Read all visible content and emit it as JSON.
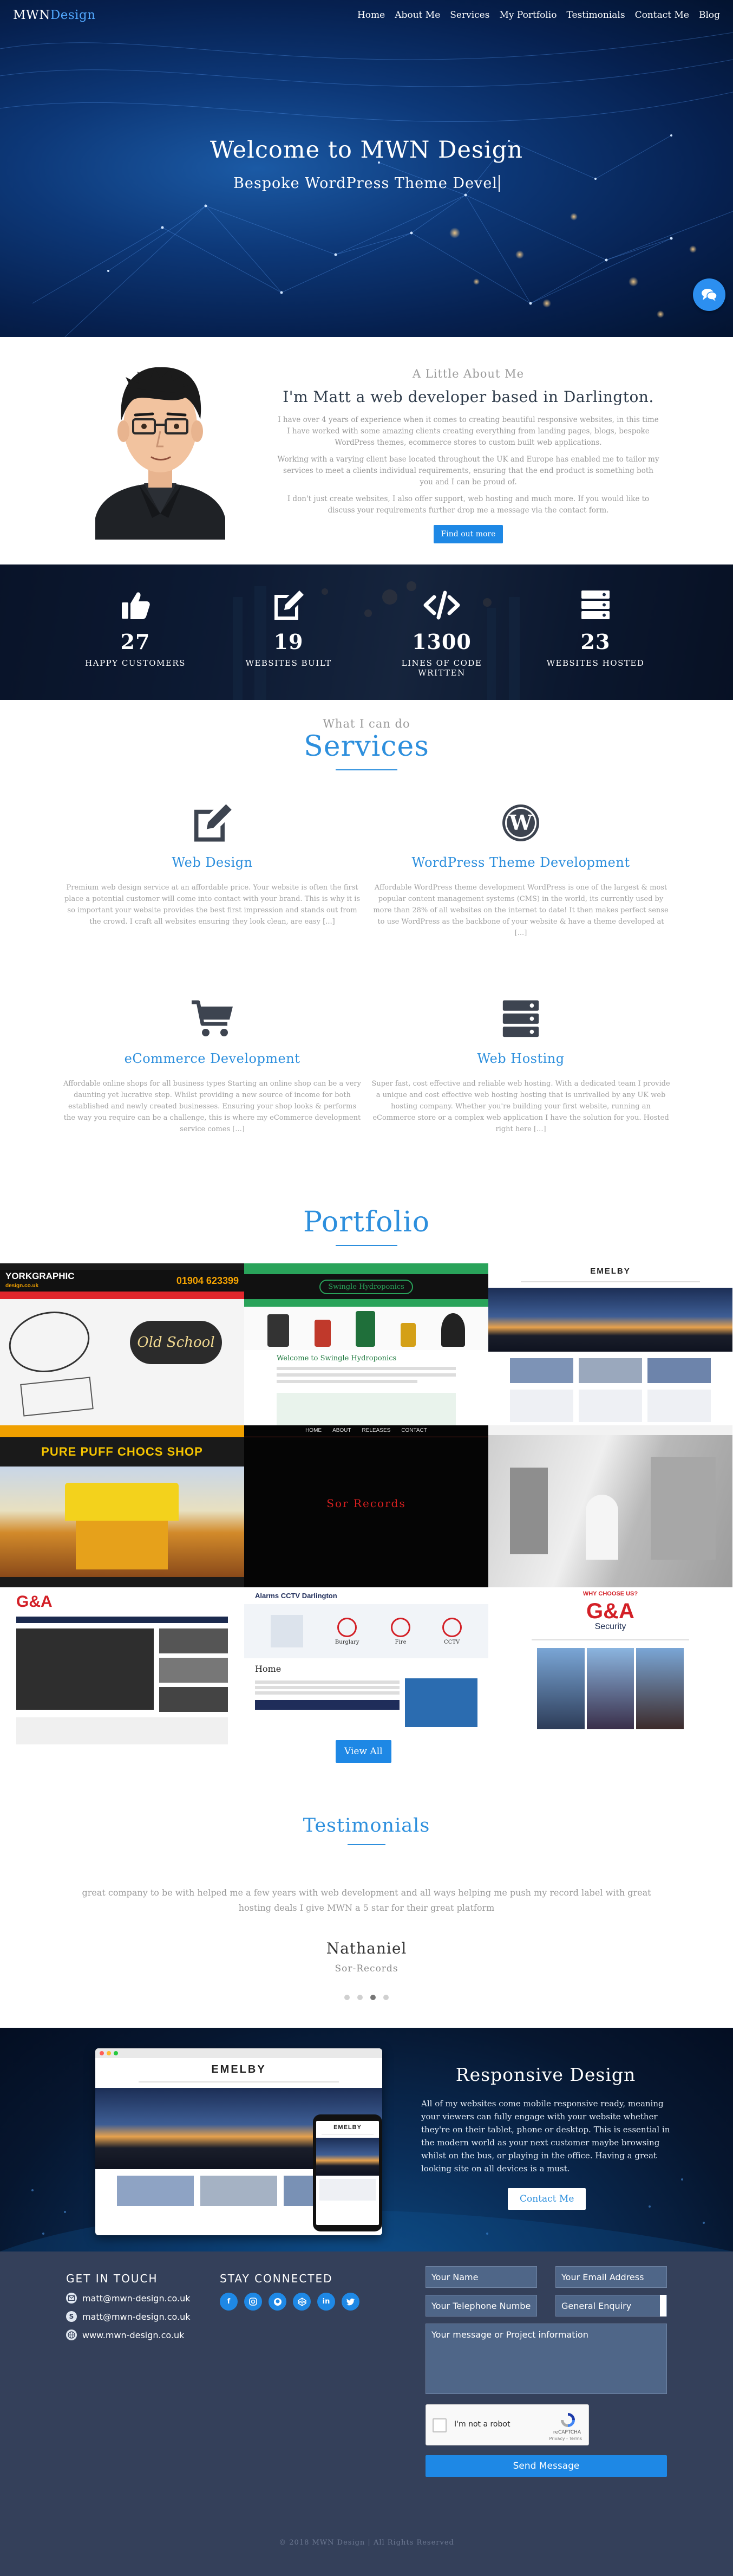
{
  "nav": {
    "logo_main": "MWN",
    "logo_accent": "Design",
    "items": [
      "Home",
      "About Me",
      "Services",
      "My Portfolio",
      "Testimonials",
      "Contact Me",
      "Blog"
    ]
  },
  "hero": {
    "title": "Welcome to MWN Design",
    "subtitle": "Bespoke WordPress Theme Devel",
    "chat_icon": "chat-bubbles-icon"
  },
  "about": {
    "kicker": "A Little About Me",
    "heading": "I'm Matt a web developer based in Darlington.",
    "p1": "I have over 4 years of experience when it comes to creating beautiful responsive websites, in this time I have worked with some amazing clients creating everything from landing pages, blogs, bespoke WordPress themes, ecommerce stores to custom built web applications.",
    "p2": "Working with a varying client base located throughout the UK and Europe has enabled me to tailor my services to meet a clients individual requirements, ensuring that the end product is something both you and I can be proud of.",
    "p3": "I don't just create websites, I also offer support, web hosting and much more. If you would like to discuss your requirements further drop me a message via the contact form.",
    "button": "Find out more"
  },
  "stats": [
    {
      "icon": "thumbs-up-icon",
      "value": "27",
      "label": "HAPPY CUSTOMERS"
    },
    {
      "icon": "edit-icon",
      "value": "19",
      "label": "WEBSITES BUILT"
    },
    {
      "icon": "code-icon",
      "value": "1300",
      "label": "LINES OF CODE WRITTEN"
    },
    {
      "icon": "server-icon",
      "value": "23",
      "label": "WEBSITES HOSTED"
    }
  ],
  "services": {
    "kicker": "What I can do",
    "title": "Services",
    "items": [
      {
        "icon": "edit-icon",
        "title": "Web Design",
        "text": "Premium web design service at an affordable price. Your website is often the first place a potential customer will come into contact with your brand. This is why it is so important your website provides the best first impression and stands out from the crowd. I craft all websites ensuring they look clean, are easy [...]"
      },
      {
        "icon": "wordpress-icon",
        "title": "WordPress Theme Development",
        "text": "Affordable WordPress theme development WordPress is one of the largest & most popular content management systems (CMS) in the world, its currently used by more than 28% of all websites on the internet to date! It then makes perfect sense to use WordPress as the backbone of your website & have a theme developed at [...]"
      },
      {
        "icon": "shopping-cart-icon",
        "title": "eCommerce Development",
        "text": "Affordable online shops for all business types Starting an online shop can be a very daunting yet lucrative step. Whilst providing a new source of income for both established and newly created businesses. Ensuring your shop looks & performs the way you require can be a challenge, this is where my eCommerce development service comes [...]"
      },
      {
        "icon": "server-icon",
        "title": "Web Hosting",
        "text": "Super fast, cost effective and reliable web hosting. With a dedicated team I provide a unique and cost effective web hosting hosting that is unrivalled by any UK web hosting company. Whether you're building your first website, running an eCommerce store or a complex web application I have the solution for you. Hosted right here [...]"
      }
    ]
  },
  "portfolio": {
    "title": "Portfolio",
    "tiles": [
      {
        "site": "York Graphic Design",
        "logo": "YORKGRAPHIC",
        "logo2": "design.co.uk",
        "phone": "01904 623399",
        "caption": "Old School"
      },
      {
        "site": "Swingle Hydroponics",
        "logo": "Swingle Hydroponics",
        "caption": "Welcome to Swingle Hydroponics"
      },
      {
        "site": "Emelby",
        "logo": "EMELBY"
      },
      {
        "site": "Pure Puff Chocs",
        "logo": "PURE PUFF CHOCS SHOP"
      },
      {
        "site": "Sor Records",
        "logo": "Sor Records",
        "menu": [
          "HOME",
          "ABOUT",
          "RELEASES",
          "CONTACT"
        ]
      },
      {
        "site": "Emelby Interiors"
      },
      {
        "site": "G&A Security",
        "logo": "G&A"
      },
      {
        "site": "Alarms CCTV Darlington",
        "logo": "Alarms CCTV Darlington",
        "badges": [
          "Burglary",
          "Fire",
          "CCTV"
        ],
        "heading": "Home"
      },
      {
        "site": "G&A Security",
        "logo": "G&A",
        "logo2": "Security",
        "kicker": "WHY CHOOSE US?"
      }
    ],
    "button": "View All"
  },
  "testimonials": {
    "title": "Testimonials",
    "quote": "great company to be with helped me a few years with web development and all ways helping me push my record label with great hosting deals I give MWN a 5 star for their great platform",
    "name": "Nathaniel",
    "role": "Sor-Records",
    "dots": 4,
    "active_dot": 2
  },
  "responsive": {
    "title": "Responsive Design",
    "text": "All of my websites come mobile responsive ready, meaning your viewers can fully engage with your website whether they're on their tablet, phone or desktop. This is essential in the modern world as your next customer maybe browsing whilst on the bus, or playing in the office. Having a great looking site on all devices is a must.",
    "button": "Contact Me",
    "mockup_logo": "EMELBY"
  },
  "footer": {
    "get_in_touch": "GET IN TOUCH",
    "contacts": [
      {
        "icon": "envelope-icon",
        "text": "matt@mwn-design.co.uk"
      },
      {
        "icon": "skype-icon",
        "text": "matt@mwn-design.co.uk"
      },
      {
        "icon": "globe-icon",
        "text": "www.mwn-design.co.uk"
      }
    ],
    "stay_connected": "STAY CONNECTED",
    "socials": [
      "facebook",
      "instagram",
      "github",
      "codepen",
      "linkedin",
      "twitter"
    ],
    "form": {
      "name": "Your Name",
      "email": "Your Email Address",
      "phone": "Your Telephone Numbe",
      "enquiry": "General Enquiry",
      "message": "Your message or Project information",
      "captcha_label": "I'm not a robot",
      "captcha_brand": "reCAPTCHA",
      "captcha_links": "Privacy - Terms",
      "send": "Send Message"
    },
    "copyright": "© 2018 MWN Design | All Rights Reserved"
  },
  "colors": {
    "accent": "#2d8fdd",
    "button": "#1e88e5",
    "footer_bg": "#34405a",
    "hero_bg": "#0d3878"
  }
}
